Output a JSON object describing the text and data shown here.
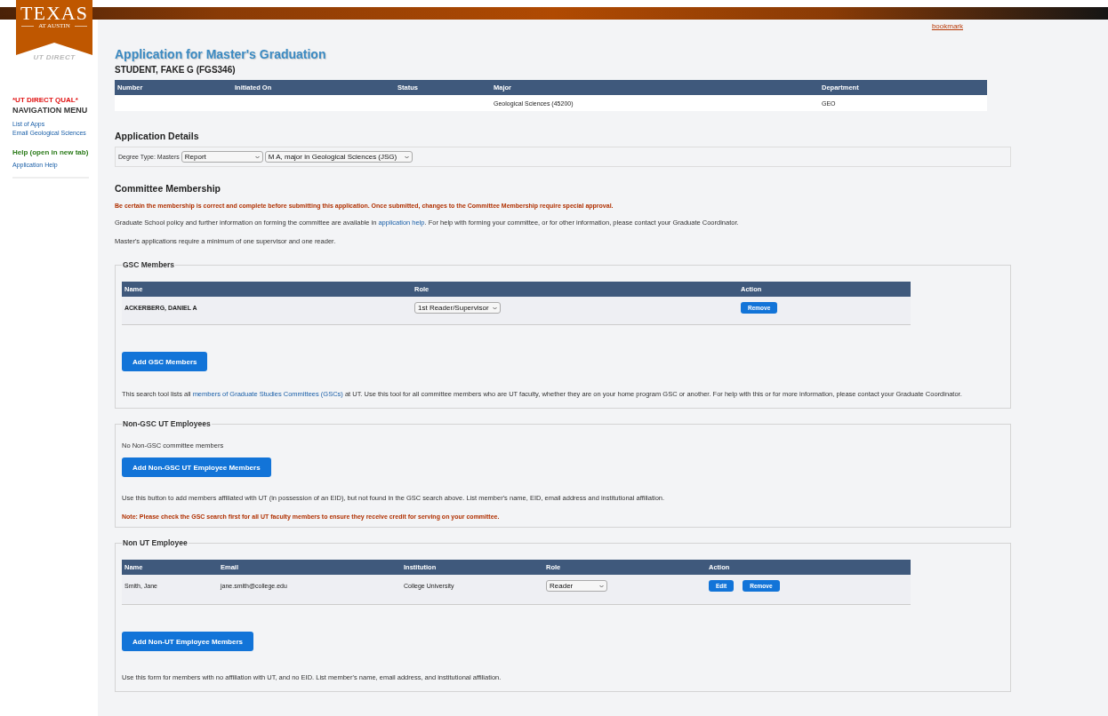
{
  "logo": {
    "wordmark": "TEXAS",
    "subtitle": "AT AUSTIN",
    "sub_brand": "UT DIRECT"
  },
  "sidebar": {
    "environment": "*UT DIRECT QUAL*",
    "menu_title": "NAVIGATION MENU",
    "links": [
      "List of Apps",
      "Email Geological Sciences"
    ],
    "help_title": "Help (open in new tab)",
    "help_links": [
      "Application Help"
    ]
  },
  "bookmark": "bookmark",
  "title": "Application for Master's Graduation",
  "student": "STUDENT, FAKE G (FGS346)",
  "summary": {
    "columns": [
      "Number",
      "Initiated On",
      "Status",
      "Major",
      "Department"
    ],
    "row": {
      "major": "Geological Sciences (45200)",
      "department": "GEO"
    }
  },
  "details": {
    "heading": "Application Details",
    "label": "Degree Type: Masters",
    "selects": [
      "Report",
      "M A, major in Geological Sciences (JSG)"
    ]
  },
  "committee": {
    "heading": "Committee Membership",
    "warning": "Be certain the membership is correct and complete before submitting this application. Once submitted, changes to the Committee Membership require special approval.",
    "info": [
      {
        "kind": "text",
        "text": "Graduate School policy and further information on forming the committee are available in "
      },
      {
        "kind": "link",
        "text": "application help"
      },
      {
        "kind": "text",
        "text": ". For help with forming your committee, or for other information, please contact your Graduate Coordinator."
      }
    ],
    "minimum": "Master's applications require a minimum of one supervisor and one reader."
  },
  "gsc": {
    "legend": "GSC Members",
    "columns": [
      "Name",
      "Role",
      "Action"
    ],
    "rows": [
      {
        "name": "ACKERBERG, DANIEL A",
        "role": "1st Reader/Supervisor",
        "actions": [
          "Remove"
        ]
      }
    ],
    "add_button": "Add GSC Members",
    "note": [
      {
        "kind": "text",
        "text": "This search tool lists all "
      },
      {
        "kind": "link",
        "text": "members of Graduate Studies Committees (GSCs)"
      },
      {
        "kind": "text",
        "text": " at UT. Use this tool for all committee members who are UT faculty, whether they are on your home program GSC or another. For help with this or for more information, please contact your Graduate Coordinator."
      }
    ]
  },
  "non_gsc": {
    "legend": "Non-GSC UT Employees",
    "empty": "No Non-GSC committee members",
    "add_button": "Add Non-GSC UT Employee Members",
    "note": "Use this button to add members affiliated with UT (in possession of an EID), but not found in the GSC search above. List member's name, EID, email address and institutional affiliation.",
    "warning": "Note: Please check the GSC search first for all UT faculty members to ensure they receive credit for serving on your committee."
  },
  "non_ut": {
    "legend": "Non UT Employee",
    "columns": [
      "Name",
      "Email",
      "Institution",
      "Role",
      "Action"
    ],
    "rows": [
      {
        "name": "Smith, Jane",
        "email": "jane.smith@college.edu",
        "institution": "College University",
        "role": "Reader",
        "actions": [
          "Edit",
          "Remove"
        ]
      }
    ],
    "add_button": "Add Non-UT Employee Members",
    "note": "Use this form for members with no affiliation with UT, and no EID. List member's name, email address, and institutional affiliation."
  }
}
